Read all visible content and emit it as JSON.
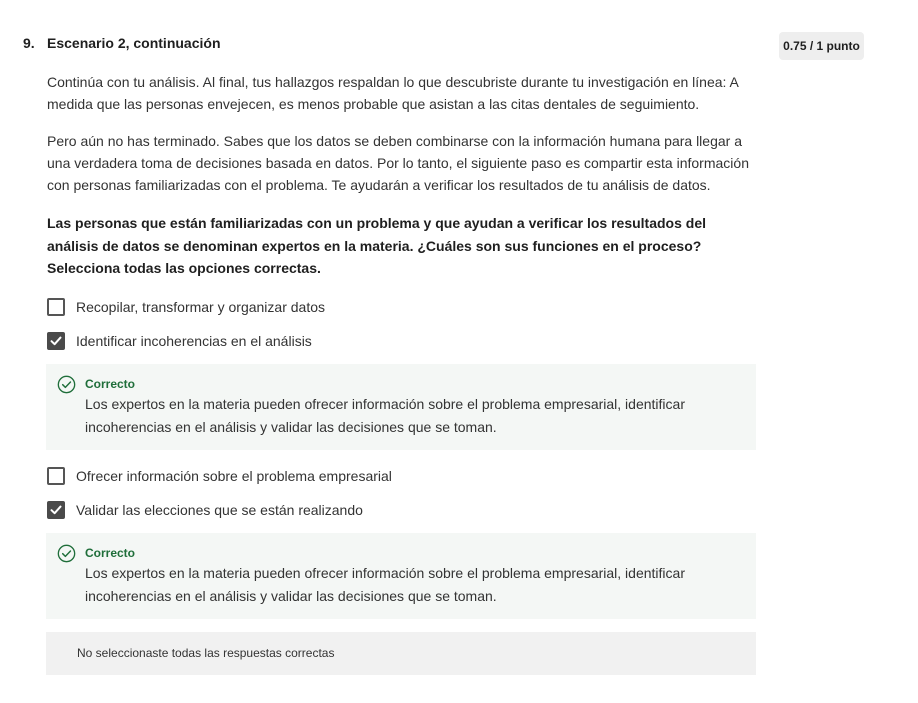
{
  "question": {
    "number": "9.",
    "title": "Escenario 2, continuación",
    "score": "0.75 / 1 punto",
    "paragraphs": [
      "Continúa con tu análisis. Al final, tus hallazgos respaldan lo que descubriste durante tu investigación en línea: A medida que las personas envejecen, es menos probable que asistan a las citas dentales de seguimiento.",
      "Pero aún no has terminado. Sabes que los datos se deben combinarse con la información humana para llegar a una verdadera toma de decisiones basada en datos. Por lo tanto, el siguiente paso es compartir esta información con personas familiarizadas con el problema. Te ayudarán a verificar los resultados de tu análisis de datos."
    ],
    "prompt": "Las personas que están familiarizadas con un problema y que ayudan a verificar los resultados del análisis de datos se denominan expertos en la materia. ¿Cuáles son sus funciones en el proceso? Selecciona todas las opciones correctas."
  },
  "options": [
    {
      "label": "Recopilar, transformar y organizar datos",
      "checked": false
    },
    {
      "label": "Identificar incoherencias en el análisis",
      "checked": true
    },
    {
      "label": "Ofrecer información sobre el problema empresarial",
      "checked": false
    },
    {
      "label": "Validar las elecciones que se están realizando",
      "checked": true
    }
  ],
  "feedback": [
    {
      "title": "Correcto",
      "text": "Los expertos en la materia pueden ofrecer información sobre el problema empresarial, identificar incoherencias en el análisis y validar las decisiones que se toman."
    },
    {
      "title": "Correcto",
      "text": "Los expertos en la materia pueden ofrecer información sobre el problema empresarial, identificar incoherencias en el análisis y validar las decisiones que se toman."
    }
  ],
  "summary": "No seleccionaste todas las respuestas correctas",
  "icons": {
    "correct": "check-circle-icon",
    "checkbox_checked": "checkmark-icon"
  },
  "colors": {
    "correct_green": "#1f6e3a",
    "feedback_bg": "#f4f7f5",
    "checkbox_fill": "#4a4a4a"
  }
}
